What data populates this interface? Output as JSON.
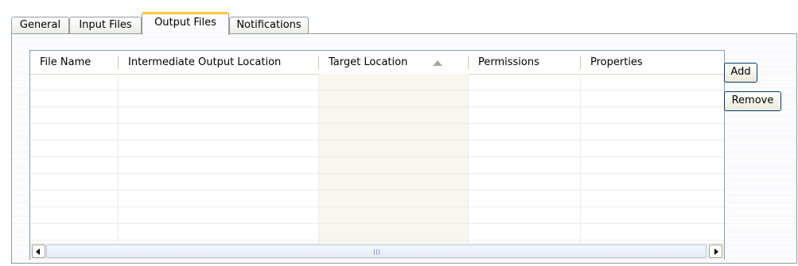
{
  "tabs": [
    {
      "label": "General",
      "active": false
    },
    {
      "label": "Input Files",
      "active": false
    },
    {
      "label": "Output Files",
      "active": true
    },
    {
      "label": "Notifications",
      "active": false
    }
  ],
  "table": {
    "columns": [
      {
        "label": "File Name"
      },
      {
        "label": "Intermediate Output Location"
      },
      {
        "label": "Target Location",
        "sorted": "ascending"
      },
      {
        "label": "Permissions"
      },
      {
        "label": "Properties"
      }
    ],
    "rows": []
  },
  "buttons": {
    "add_label": "Add",
    "remove_label": "Remove"
  },
  "icons": {
    "sort": "sort-ascending-icon",
    "scroll_left": "scroll-left-arrow-icon",
    "scroll_right": "scroll-right-arrow-icon",
    "grip": "scroll-thumb-grip-icon"
  },
  "colors": {
    "active_tab_accent": "#ffc83c",
    "sorted_column_bg": "#f7f7f0",
    "button_border": "#003c74"
  }
}
